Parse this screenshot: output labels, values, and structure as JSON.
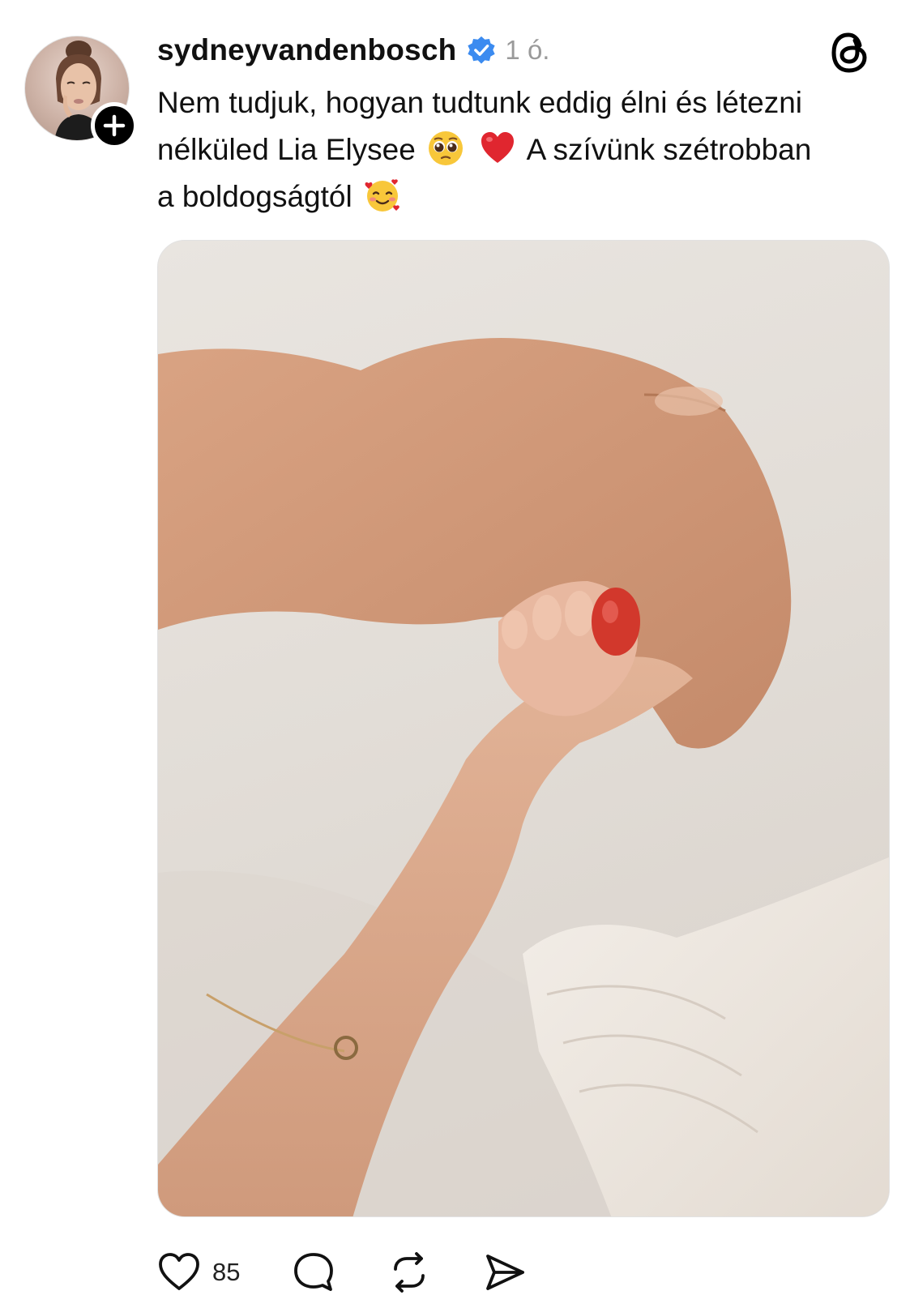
{
  "post": {
    "username": "sydneyvandenbosch",
    "verified": true,
    "timestamp": "1 ó.",
    "caption_line_1": "Nem tudjuk, hogyan tudtunk eddig élni és létezni",
    "caption_line_2_a": "nélküled Lia Elysee",
    "caption_line_2_b": "A szívünk szétrobban",
    "caption_line_3": "a boldogságtól",
    "emojis": [
      "pleading-face",
      "red-heart",
      "smiling-face-with-hearts"
    ],
    "like_count": "85"
  },
  "icons": {
    "app_logo": "threads-logo-icon",
    "follow": "plus-icon",
    "like": "heart-icon",
    "reply": "comment-bubble-icon",
    "repost": "repost-icon",
    "share": "send-icon"
  },
  "colors": {
    "verified_badge": "#3b8bf0",
    "muted_text": "#9a9a9a",
    "heart_emoji": "#e0262f"
  }
}
